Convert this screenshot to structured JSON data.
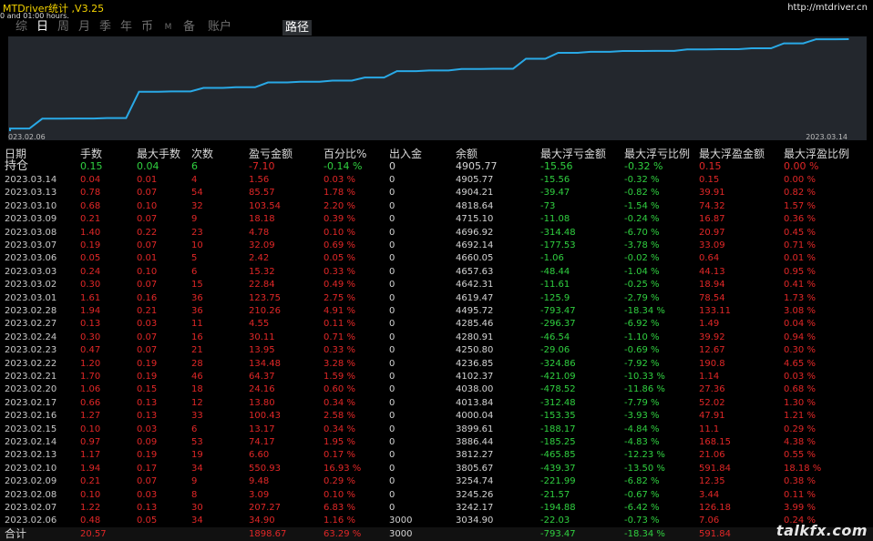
{
  "window": {
    "title": "MTDriver统计 ,V3.25",
    "subtitle": "0 and 01:00 hours.",
    "site": "http://mtdriver.cn"
  },
  "tabs": [
    {
      "label": "综",
      "active": false
    },
    {
      "label": "日",
      "active": true
    },
    {
      "label": "周",
      "active": false
    },
    {
      "label": "月",
      "active": false
    },
    {
      "label": "季",
      "active": false
    },
    {
      "label": "年",
      "active": false
    },
    {
      "label": "币",
      "active": false
    },
    {
      "label": "M",
      "active": false
    },
    {
      "label": "备",
      "active": false
    },
    {
      "label": "账户",
      "active": false
    }
  ],
  "route_tab": "路径",
  "chart": {
    "start_date": "023.02.06",
    "end_date": "2023.03.14",
    "line_color": "#29a9e6",
    "background": "#23272d"
  },
  "chart_data": {
    "type": "line",
    "x": [
      "2023.02.06",
      "2023.02.07",
      "2023.02.08",
      "2023.02.09",
      "2023.02.10",
      "2023.02.13",
      "2023.02.14",
      "2023.02.15",
      "2023.02.16",
      "2023.02.17",
      "2023.02.20",
      "2023.02.21",
      "2023.02.22",
      "2023.02.23",
      "2023.02.24",
      "2023.02.27",
      "2023.02.28",
      "2023.03.01",
      "2023.03.02",
      "2023.03.03",
      "2023.03.06",
      "2023.03.07",
      "2023.03.08",
      "2023.03.09",
      "2023.03.10",
      "2023.03.13",
      "2023.03.14"
    ],
    "series": [
      {
        "values": [
          3034.9,
          3242.17,
          3245.26,
          3254.74,
          3805.67,
          3812.27,
          3886.44,
          3899.61,
          4000.04,
          4013.84,
          4038.0,
          4102.37,
          4236.85,
          4250.8,
          4280.91,
          4285.46,
          4495.72,
          4619.47,
          4642.31,
          4657.63,
          4660.05,
          4692.14,
          4696.92,
          4715.1,
          4818.64,
          4904.21,
          4905.77
        ]
      }
    ]
  },
  "columns": [
    "日期",
    "手数",
    "最大手数",
    "次数",
    "盈亏金额",
    "百分比%",
    "出入金",
    "余额",
    "最大浮亏金额",
    "最大浮亏比例",
    "最大浮盈金额",
    "最大浮盈比例"
  ],
  "hold": {
    "date": "持仓",
    "lots": "0.15",
    "max_lots": "0.04",
    "count": "6",
    "pl": "-7.10",
    "pct": "-0.14 %",
    "io": "0",
    "balance": "4905.77",
    "max_dd": "-15.56",
    "max_dd_pct": "-0.32 %",
    "max_fp": "0.15",
    "max_fp_pct": "0.00 %"
  },
  "rows": [
    {
      "date": "2023.03.14",
      "lots": "0.04",
      "max_lots": "0.01",
      "count": "4",
      "pl": "1.56",
      "pct": "0.03 %",
      "io": "0",
      "balance": "4905.77",
      "max_dd": "-15.56",
      "max_dd_pct": "-0.32 %",
      "max_fp": "0.15",
      "max_fp_pct": "0.00 %"
    },
    {
      "date": "2023.03.13",
      "lots": "0.78",
      "max_lots": "0.07",
      "count": "54",
      "pl": "85.57",
      "pct": "1.78 %",
      "io": "0",
      "balance": "4904.21",
      "max_dd": "-39.47",
      "max_dd_pct": "-0.82 %",
      "max_fp": "39.91",
      "max_fp_pct": "0.82 %"
    },
    {
      "date": "2023.03.10",
      "lots": "0.68",
      "max_lots": "0.10",
      "count": "32",
      "pl": "103.54",
      "pct": "2.20 %",
      "io": "0",
      "balance": "4818.64",
      "max_dd": "-73",
      "max_dd_pct": "-1.54 %",
      "max_fp": "74.32",
      "max_fp_pct": "1.57 %"
    },
    {
      "date": "2023.03.09",
      "lots": "0.21",
      "max_lots": "0.07",
      "count": "9",
      "pl": "18.18",
      "pct": "0.39 %",
      "io": "0",
      "balance": "4715.10",
      "max_dd": "-11.08",
      "max_dd_pct": "-0.24 %",
      "max_fp": "16.87",
      "max_fp_pct": "0.36 %"
    },
    {
      "date": "2023.03.08",
      "lots": "1.40",
      "max_lots": "0.22",
      "count": "23",
      "pl": "4.78",
      "pct": "0.10 %",
      "io": "0",
      "balance": "4696.92",
      "max_dd": "-314.48",
      "max_dd_pct": "-6.70 %",
      "max_fp": "20.97",
      "max_fp_pct": "0.45 %"
    },
    {
      "date": "2023.03.07",
      "lots": "0.19",
      "max_lots": "0.07",
      "count": "10",
      "pl": "32.09",
      "pct": "0.69 %",
      "io": "0",
      "balance": "4692.14",
      "max_dd": "-177.53",
      "max_dd_pct": "-3.78 %",
      "max_fp": "33.09",
      "max_fp_pct": "0.71 %"
    },
    {
      "date": "2023.03.06",
      "lots": "0.05",
      "max_lots": "0.01",
      "count": "5",
      "pl": "2.42",
      "pct": "0.05 %",
      "io": "0",
      "balance": "4660.05",
      "max_dd": "-1.06",
      "max_dd_pct": "-0.02 %",
      "max_fp": "0.64",
      "max_fp_pct": "0.01 %"
    },
    {
      "date": "2023.03.03",
      "lots": "0.24",
      "max_lots": "0.10",
      "count": "6",
      "pl": "15.32",
      "pct": "0.33 %",
      "io": "0",
      "balance": "4657.63",
      "max_dd": "-48.44",
      "max_dd_pct": "-1.04 %",
      "max_fp": "44.13",
      "max_fp_pct": "0.95 %"
    },
    {
      "date": "2023.03.02",
      "lots": "0.30",
      "max_lots": "0.07",
      "count": "15",
      "pl": "22.84",
      "pct": "0.49 %",
      "io": "0",
      "balance": "4642.31",
      "max_dd": "-11.61",
      "max_dd_pct": "-0.25 %",
      "max_fp": "18.94",
      "max_fp_pct": "0.41 %"
    },
    {
      "date": "2023.03.01",
      "lots": "1.61",
      "max_lots": "0.16",
      "count": "36",
      "pl": "123.75",
      "pct": "2.75 %",
      "io": "0",
      "balance": "4619.47",
      "max_dd": "-125.9",
      "max_dd_pct": "-2.79 %",
      "max_fp": "78.54",
      "max_fp_pct": "1.73 %"
    },
    {
      "date": "2023.02.28",
      "lots": "1.94",
      "max_lots": "0.21",
      "count": "36",
      "pl": "210.26",
      "pct": "4.91 %",
      "io": "0",
      "balance": "4495.72",
      "max_dd": "-793.47",
      "max_dd_pct": "-18.34 %",
      "max_fp": "133.11",
      "max_fp_pct": "3.08 %"
    },
    {
      "date": "2023.02.27",
      "lots": "0.13",
      "max_lots": "0.03",
      "count": "11",
      "pl": "4.55",
      "pct": "0.11 %",
      "io": "0",
      "balance": "4285.46",
      "max_dd": "-296.37",
      "max_dd_pct": "-6.92 %",
      "max_fp": "1.49",
      "max_fp_pct": "0.04 %"
    },
    {
      "date": "2023.02.24",
      "lots": "0.30",
      "max_lots": "0.07",
      "count": "16",
      "pl": "30.11",
      "pct": "0.71 %",
      "io": "0",
      "balance": "4280.91",
      "max_dd": "-46.54",
      "max_dd_pct": "-1.10 %",
      "max_fp": "39.92",
      "max_fp_pct": "0.94 %"
    },
    {
      "date": "2023.02.23",
      "lots": "0.47",
      "max_lots": "0.07",
      "count": "21",
      "pl": "13.95",
      "pct": "0.33 %",
      "io": "0",
      "balance": "4250.80",
      "max_dd": "-29.06",
      "max_dd_pct": "-0.69 %",
      "max_fp": "12.67",
      "max_fp_pct": "0.30 %"
    },
    {
      "date": "2023.02.22",
      "lots": "1.20",
      "max_lots": "0.19",
      "count": "28",
      "pl": "134.48",
      "pct": "3.28 %",
      "io": "0",
      "balance": "4236.85",
      "max_dd": "-324.86",
      "max_dd_pct": "-7.92 %",
      "max_fp": "190.8",
      "max_fp_pct": "4.65 %"
    },
    {
      "date": "2023.02.21",
      "lots": "1.70",
      "max_lots": "0.19",
      "count": "46",
      "pl": "64.37",
      "pct": "1.59 %",
      "io": "0",
      "balance": "4102.37",
      "max_dd": "-421.09",
      "max_dd_pct": "-10.33 %",
      "max_fp": "1.14",
      "max_fp_pct": "0.03 %"
    },
    {
      "date": "2023.02.20",
      "lots": "1.06",
      "max_lots": "0.15",
      "count": "18",
      "pl": "24.16",
      "pct": "0.60 %",
      "io": "0",
      "balance": "4038.00",
      "max_dd": "-478.52",
      "max_dd_pct": "-11.86 %",
      "max_fp": "27.36",
      "max_fp_pct": "0.68 %"
    },
    {
      "date": "2023.02.17",
      "lots": "0.66",
      "max_lots": "0.13",
      "count": "12",
      "pl": "13.80",
      "pct": "0.34 %",
      "io": "0",
      "balance": "4013.84",
      "max_dd": "-312.48",
      "max_dd_pct": "-7.79 %",
      "max_fp": "52.02",
      "max_fp_pct": "1.30 %"
    },
    {
      "date": "2023.02.16",
      "lots": "1.27",
      "max_lots": "0.13",
      "count": "33",
      "pl": "100.43",
      "pct": "2.58 %",
      "io": "0",
      "balance": "4000.04",
      "max_dd": "-153.35",
      "max_dd_pct": "-3.93 %",
      "max_fp": "47.91",
      "max_fp_pct": "1.21 %"
    },
    {
      "date": "2023.02.15",
      "lots": "0.10",
      "max_lots": "0.03",
      "count": "6",
      "pl": "13.17",
      "pct": "0.34 %",
      "io": "0",
      "balance": "3899.61",
      "max_dd": "-188.17",
      "max_dd_pct": "-4.84 %",
      "max_fp": "11.1",
      "max_fp_pct": "0.29 %"
    },
    {
      "date": "2023.02.14",
      "lots": "0.97",
      "max_lots": "0.09",
      "count": "53",
      "pl": "74.17",
      "pct": "1.95 %",
      "io": "0",
      "balance": "3886.44",
      "max_dd": "-185.25",
      "max_dd_pct": "-4.83 %",
      "max_fp": "168.15",
      "max_fp_pct": "4.38 %"
    },
    {
      "date": "2023.02.13",
      "lots": "1.17",
      "max_lots": "0.19",
      "count": "19",
      "pl": "6.60",
      "pct": "0.17 %",
      "io": "0",
      "balance": "3812.27",
      "max_dd": "-465.85",
      "max_dd_pct": "-12.23 %",
      "max_fp": "21.06",
      "max_fp_pct": "0.55 %"
    },
    {
      "date": "2023.02.10",
      "lots": "1.94",
      "max_lots": "0.17",
      "count": "34",
      "pl": "550.93",
      "pct": "16.93 %",
      "io": "0",
      "balance": "3805.67",
      "max_dd": "-439.37",
      "max_dd_pct": "-13.50 %",
      "max_fp": "591.84",
      "max_fp_pct": "18.18 %"
    },
    {
      "date": "2023.02.09",
      "lots": "0.21",
      "max_lots": "0.07",
      "count": "9",
      "pl": "9.48",
      "pct": "0.29 %",
      "io": "0",
      "balance": "3254.74",
      "max_dd": "-221.99",
      "max_dd_pct": "-6.82 %",
      "max_fp": "12.35",
      "max_fp_pct": "0.38 %"
    },
    {
      "date": "2023.02.08",
      "lots": "0.10",
      "max_lots": "0.03",
      "count": "8",
      "pl": "3.09",
      "pct": "0.10 %",
      "io": "0",
      "balance": "3245.26",
      "max_dd": "-21.57",
      "max_dd_pct": "-0.67 %",
      "max_fp": "3.44",
      "max_fp_pct": "0.11 %"
    },
    {
      "date": "2023.02.07",
      "lots": "1.22",
      "max_lots": "0.13",
      "count": "30",
      "pl": "207.27",
      "pct": "6.83 %",
      "io": "0",
      "balance": "3242.17",
      "max_dd": "-194.88",
      "max_dd_pct": "-6.42 %",
      "max_fp": "126.18",
      "max_fp_pct": "3.99 %"
    },
    {
      "date": "2023.02.06",
      "lots": "0.48",
      "max_lots": "0.05",
      "count": "34",
      "pl": "34.90",
      "pct": "1.16 %",
      "io": "3000",
      "balance": "3034.90",
      "max_dd": "-22.03",
      "max_dd_pct": "-0.73 %",
      "max_fp": "7.06",
      "max_fp_pct": "0.24 %"
    }
  ],
  "total": {
    "date": "合计",
    "lots": "20.57",
    "pl": "1898.67",
    "pct": "63.29 %",
    "io": "3000",
    "max_dd": "-793.47",
    "max_dd_pct": "-18.34 %",
    "max_fp": "591.84"
  },
  "watermark": "talkfx.com",
  "colors": {
    "positive": "#e12727",
    "negative": "#30d040",
    "title": "#f5d400"
  }
}
